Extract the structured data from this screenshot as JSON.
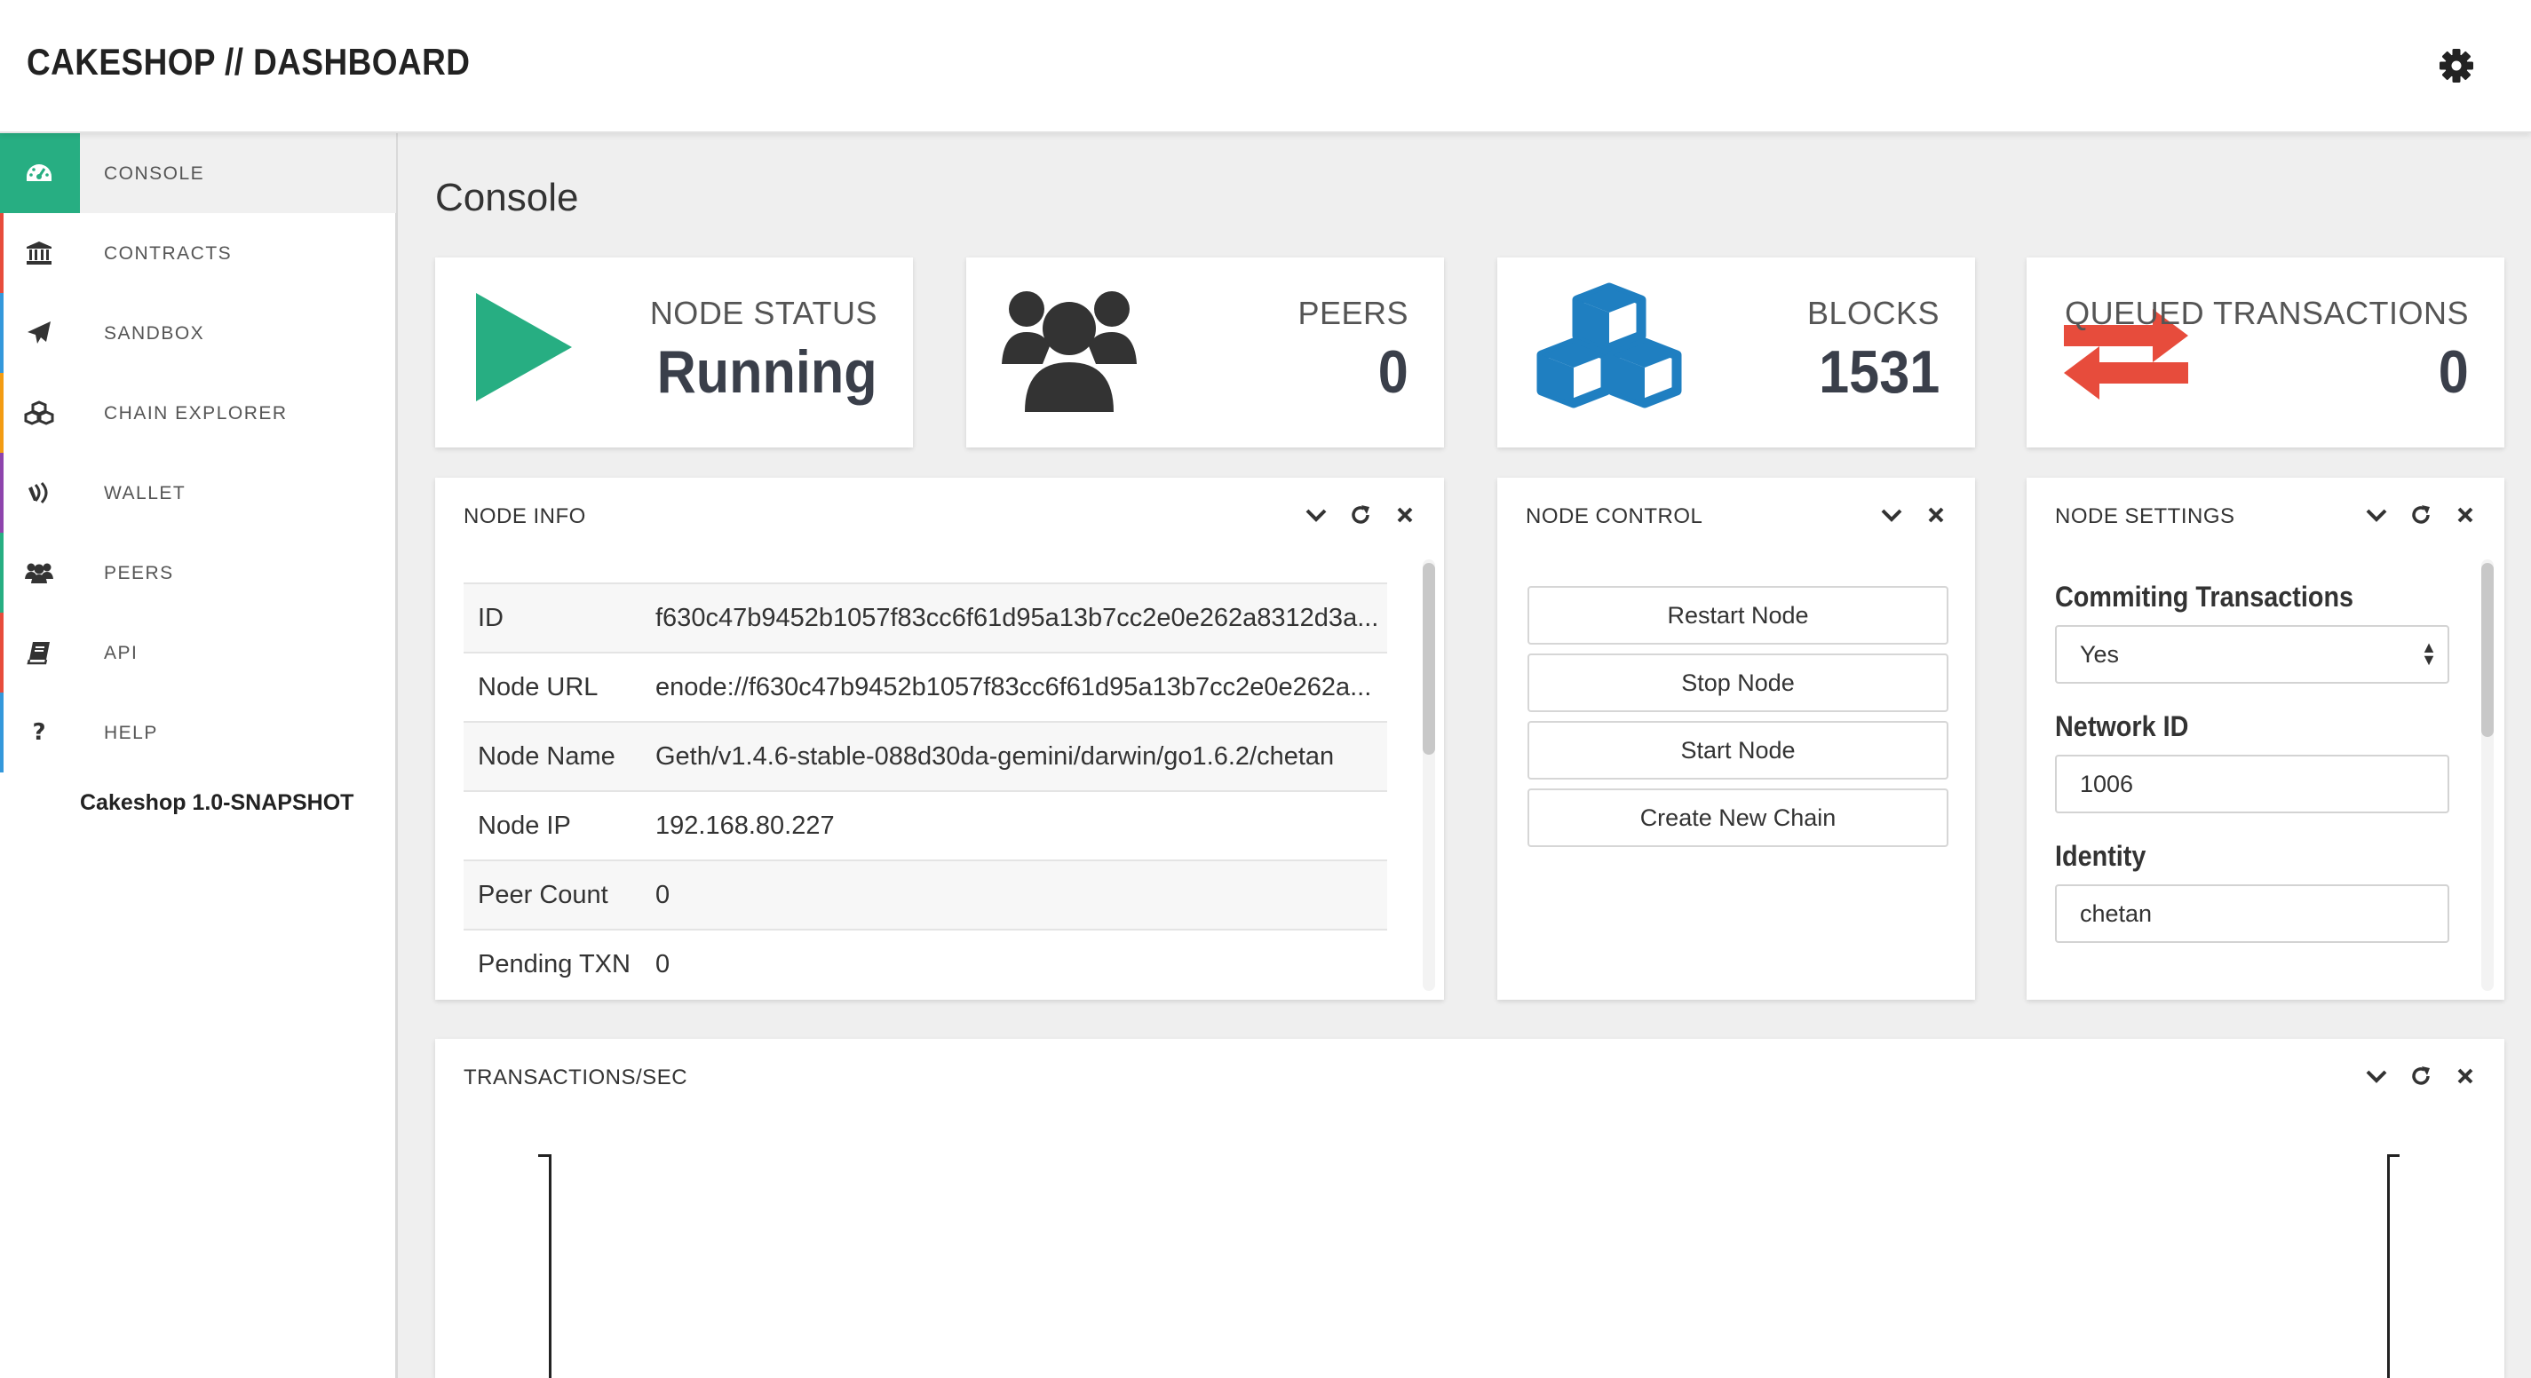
{
  "header": {
    "brand": "CAKESHOP // DASHBOARD",
    "settings_icon": "gear-icon"
  },
  "sidebar": {
    "items": [
      {
        "label": "CONSOLE",
        "icon": "dashboard-icon",
        "color": "#27ae82",
        "active": true
      },
      {
        "label": "CONTRACTS",
        "icon": "bank-icon",
        "color": "#e74c3c"
      },
      {
        "label": "SANDBOX",
        "icon": "paper-plane-icon",
        "color": "#3498db"
      },
      {
        "label": "CHAIN EXPLORER",
        "icon": "cubes-icon",
        "color": "#f39c12"
      },
      {
        "label": "WALLET",
        "icon": "wallet-icon",
        "color": "#8e44ad"
      },
      {
        "label": "PEERS",
        "icon": "users-icon",
        "color": "#27ae82"
      },
      {
        "label": "API",
        "icon": "book-icon",
        "color": "#e74c3c"
      },
      {
        "label": "HELP",
        "icon": "question-icon",
        "color": "#3498db"
      }
    ],
    "version": "Cakeshop 1.0-SNAPSHOT"
  },
  "main": {
    "title": "Console",
    "stats": [
      {
        "label": "NODE STATUS",
        "value": "Running",
        "icon": "play-icon",
        "color": "#27ae82"
      },
      {
        "label": "PEERS",
        "value": "0",
        "icon": "users-icon",
        "color": "#333333"
      },
      {
        "label": "BLOCKS",
        "value": "1531",
        "icon": "cubes-icon",
        "color": "#1f7fc1"
      },
      {
        "label": "QUEUED TRANSACTIONS",
        "value": "0",
        "icon": "exchange-icon",
        "color": "#e74c3c"
      }
    ],
    "node_info": {
      "title": "NODE INFO",
      "rows": [
        {
          "key": "ID",
          "value": "f630c47b9452b1057f83cc6f61d95a13b7cc2e0e262a8312d3a..."
        },
        {
          "key": "Node URL",
          "value": "enode://f630c47b9452b1057f83cc6f61d95a13b7cc2e0e262a..."
        },
        {
          "key": "Node Name",
          "value": "Geth/v1.4.6-stable-088d30da-gemini/darwin/go1.6.2/chetan"
        },
        {
          "key": "Node IP",
          "value": "192.168.80.227"
        },
        {
          "key": "Peer Count",
          "value": "0"
        },
        {
          "key": "Pending TXN",
          "value": "0"
        }
      ]
    },
    "node_control": {
      "title": "NODE CONTROL",
      "buttons": [
        "Restart Node",
        "Stop Node",
        "Start Node",
        "Create New Chain"
      ]
    },
    "node_settings": {
      "title": "NODE SETTINGS",
      "committing_label": "Commiting Transactions",
      "committing_value": "Yes",
      "network_label": "Network ID",
      "network_value": "1006",
      "identity_label": "Identity",
      "identity_value": "chetan"
    },
    "tps": {
      "title": "TRANSACTIONS/SEC"
    }
  }
}
